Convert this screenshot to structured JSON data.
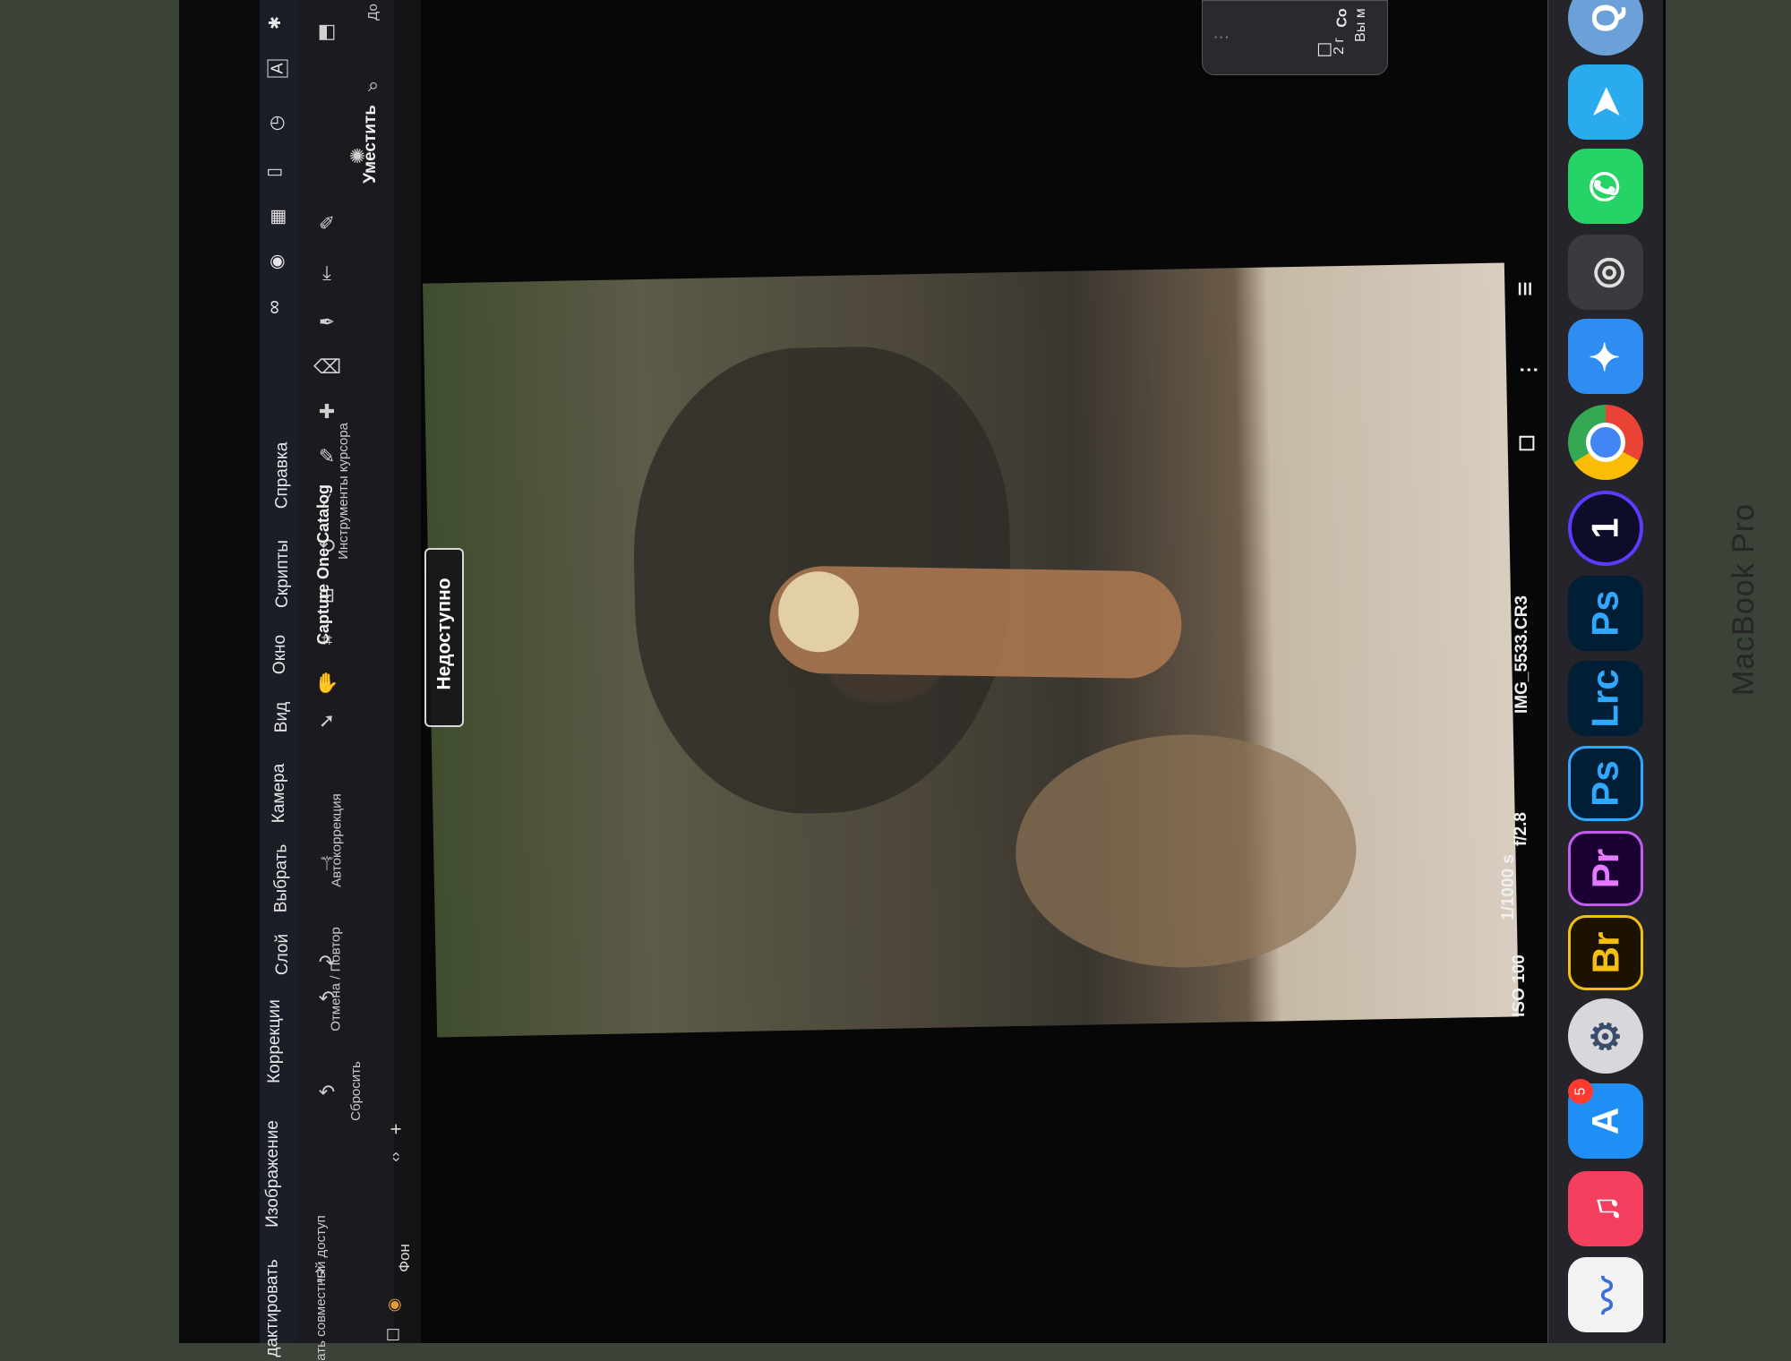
{
  "menubar": {
    "items": [
      "дактировать",
      "Изображение",
      "Коррекции",
      "Слой",
      "Выбрать",
      "Камера",
      "Вид",
      "Окно",
      "Скрипты",
      "Справка"
    ],
    "status_icons": [
      "creative-cloud-icon",
      "play-icon",
      "windows-icon",
      "phone-icon",
      "clock-icon",
      "keyboard-a-icon",
      "bluetooth-icon"
    ]
  },
  "toolbar": {
    "catalog_title": "Capture One Catalog",
    "shared_access_label": "ать совместный доступ",
    "reset_label": "Сбросить",
    "undo_redo_label": "Отмена / Повтор",
    "autocorrect_label": "Автокоррекция",
    "cursor_tools_label": "Инструменты курсора",
    "fit_label": "Уместить",
    "right_cut_label": "До"
  },
  "subbar": {
    "layer_name": "Фон"
  },
  "viewer": {
    "unavailable_label": "Недоступно",
    "iso": "ISO 100",
    "shutter": "1/1000 s",
    "aperture": "f/2.8",
    "filename": "IMG_5533.CR3"
  },
  "dock": {
    "apps": [
      {
        "name": "freeform",
        "label": ""
      },
      {
        "name": "music",
        "label": "♫"
      },
      {
        "name": "app-store",
        "label": "A",
        "badge": "5"
      },
      {
        "name": "capture-one-settings",
        "label": "⚙"
      },
      {
        "name": "bridge",
        "label": "Br"
      },
      {
        "name": "premiere",
        "label": "Pr"
      },
      {
        "name": "photoshop",
        "label": "Ps"
      },
      {
        "name": "lightroom-classic",
        "label": "Lrc"
      },
      {
        "name": "photoshop-2",
        "label": "Ps"
      },
      {
        "name": "capture-one",
        "label": "1"
      },
      {
        "name": "chrome",
        "label": ""
      },
      {
        "name": "safari",
        "label": ""
      },
      {
        "name": "photo-booth",
        "label": ""
      },
      {
        "name": "whatsapp",
        "label": "✆"
      },
      {
        "name": "telegram",
        "label": "➤"
      },
      {
        "name": "quicktime",
        "label": ""
      }
    ]
  },
  "notification": {
    "line1": "Co",
    "line2": "2 г",
    "line3": "Вы м"
  },
  "brand": "MacBook Pro"
}
